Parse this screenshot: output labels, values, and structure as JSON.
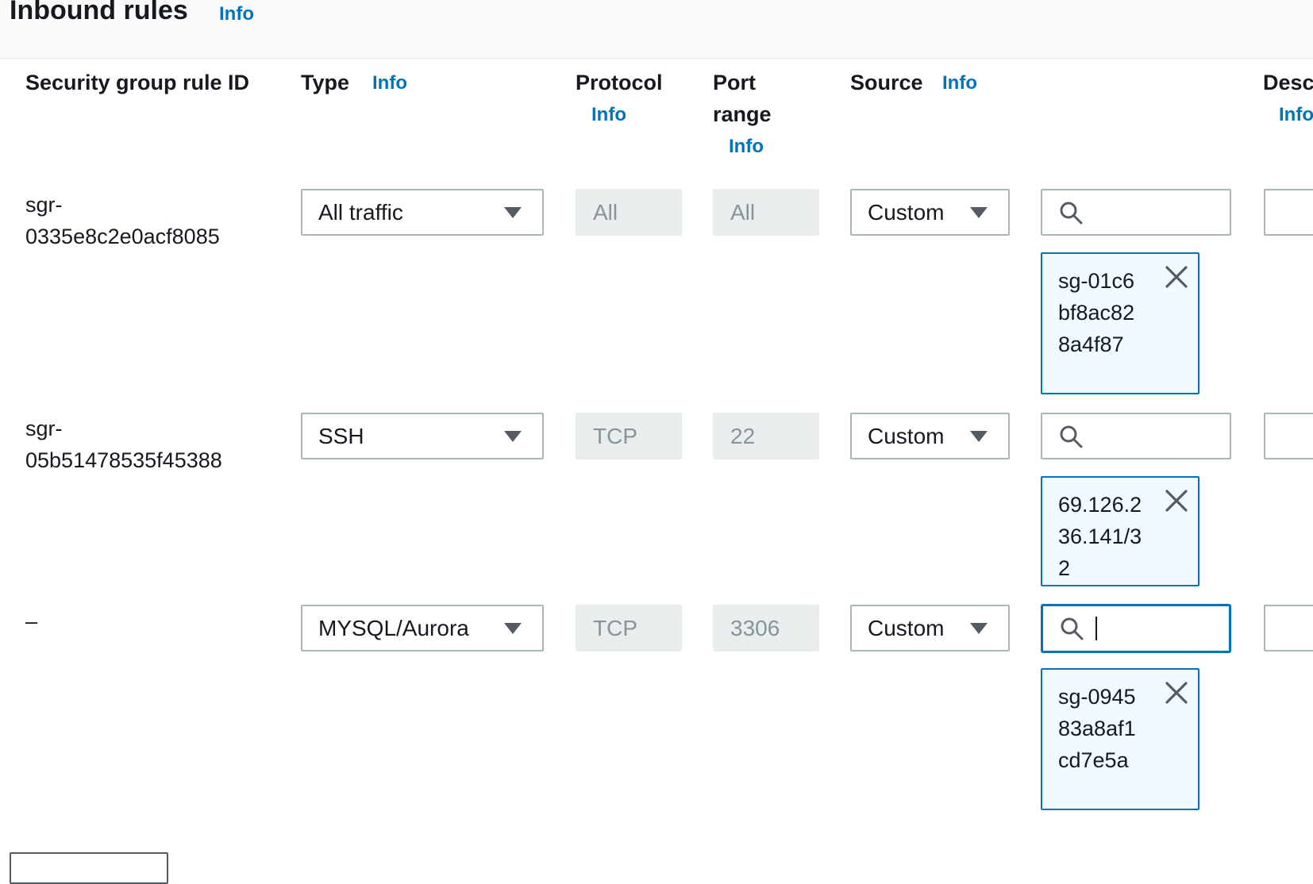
{
  "header": {
    "title": "Inbound rules",
    "info": "Info"
  },
  "columns": {
    "rule_id": "Security group rule ID",
    "type": "Type",
    "type_info": "Info",
    "protocol": "Protocol",
    "protocol_info": "Info",
    "port_line1": "Port",
    "port_line2": "range",
    "port_info": "Info",
    "source": "Source",
    "source_info": "Info",
    "description": "Desc",
    "description_info": "Info"
  },
  "rules": [
    {
      "id_line1": "sgr-",
      "id_line2": "0335e8c2e0acf8085",
      "type": "All traffic",
      "protocol": "All",
      "port_range": "All",
      "source": "Custom",
      "search_value": "",
      "token": "sg-01c6bf8ac828a4f87"
    },
    {
      "id_line1": "sgr-",
      "id_line2": "05b51478535f45388",
      "type": "SSH",
      "protocol": "TCP",
      "port_range": "22",
      "source": "Custom",
      "search_value": "",
      "token": "69.126.236.141/32"
    },
    {
      "id_line1": "–",
      "id_line2": "",
      "type": "MYSQL/Aurora",
      "protocol": "TCP",
      "port_range": "3306",
      "source": "Custom",
      "search_value": "",
      "token": "sg-094583a8af1cd7e5a"
    }
  ],
  "colors": {
    "info_link": "#0073bb",
    "token_border": "#0073bb",
    "token_bg": "#f1faff",
    "disabled_bg": "#eaeded"
  },
  "icons": [
    "search-icon",
    "close-icon",
    "caret-down-icon"
  ]
}
